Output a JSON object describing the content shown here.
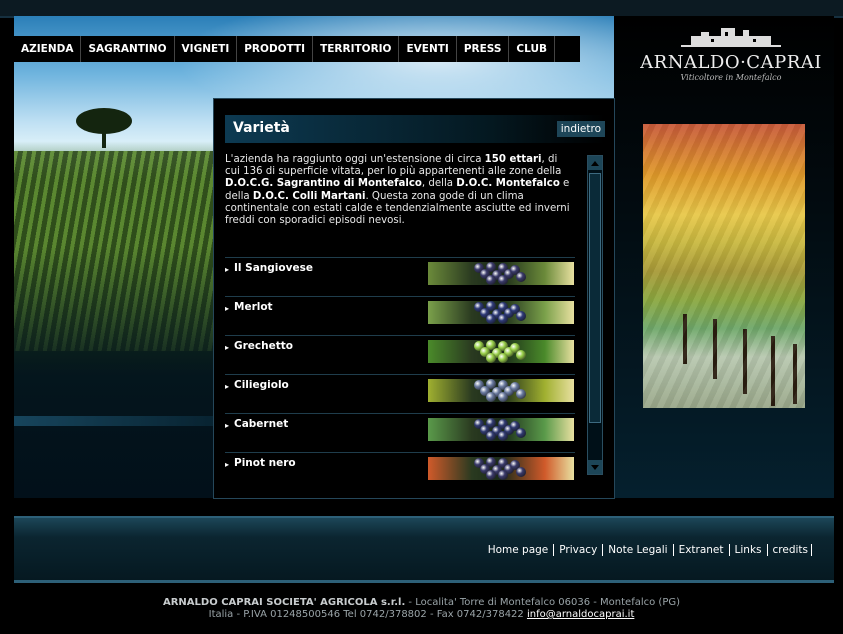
{
  "nav": {
    "items": [
      "AZIENDA",
      "SAGRANTINO",
      "VIGNETI",
      "PRODOTTI",
      "TERRITORIO",
      "EVENTI",
      "PRESS",
      "CLUB"
    ]
  },
  "logo": {
    "brand": "ARNALDO·CAPRAI",
    "tagline": "Viticoltore in Montefalco"
  },
  "page": {
    "title": "Varietà",
    "back_label": "indietro"
  },
  "intro": {
    "p1": "L'azienda ha raggiunto oggi un'estensione di circa ",
    "b1": "150 ettari",
    "p2": ", di cui 136 di superficie vitata, per lo più appartenenti alle zone della ",
    "b2": "D.O.C.G. Sagrantino di Montefalco",
    "p3": ", della ",
    "b3": "D.O.C. Montefalco",
    "p4": " e della ",
    "b4": "D.O.C. Colli Martani",
    "p5": ". Questa zona gode di un clima continentale con estati calde e tendenzialmente asciutte ed inverni freddi con sporadici episodi nevosi."
  },
  "varieties": [
    {
      "name": "Il Sangiovese",
      "grape": "#3a3a6a",
      "leaf": "#6b8a3a"
    },
    {
      "name": "Merlot",
      "grape": "#2e3a78",
      "leaf": "#7aa04a"
    },
    {
      "name": "Grechetto",
      "grape": "#9ad04a",
      "leaf": "#4a8a2a"
    },
    {
      "name": "Ciliegiolo",
      "grape": "#6a7aa0",
      "leaf": "#a0b030"
    },
    {
      "name": "Cabernet",
      "grape": "#303a70",
      "leaf": "#5a9a4a"
    },
    {
      "name": "Pinot nero",
      "grape": "#3a3a6a",
      "leaf": "#d05a2a"
    }
  ],
  "footer": {
    "links": [
      "Home page",
      "Privacy",
      "Note Legali",
      "Extranet",
      "Links",
      "credits"
    ],
    "company": "ARNALDO CAPRAI SOCIETA' AGRICOLA s.r.l.",
    "address1": " - Localita' Torre di Montefalco 06036 - Montefalco (PG)",
    "address2": "Italia - P.IVA 01248500546 Tel 0742/378802 - Fax 0742/378422 ",
    "email": "info@arnaldocaprai.it"
  },
  "colors": {
    "accent": "#1e4658",
    "border": "#25475a",
    "footer_band": "#0b2530"
  }
}
